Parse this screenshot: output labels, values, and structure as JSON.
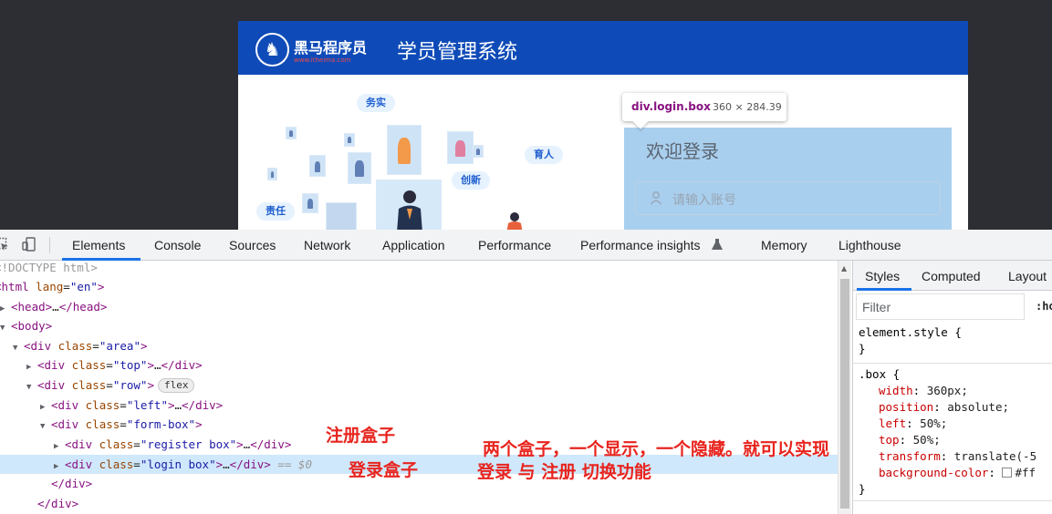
{
  "page": {
    "logo_name": "黑马程序员",
    "logo_url": "www.itheima.com",
    "system_title": "学员管理系统",
    "tags": [
      "务实",
      "育人",
      "创新",
      "责任"
    ],
    "login_title": "欢迎登录",
    "account_placeholder": "请输入账号"
  },
  "tooltip": {
    "element": "div.login.box",
    "size": "360 × 284.39"
  },
  "devtools": {
    "tabs": [
      "Elements",
      "Console",
      "Sources",
      "Network",
      "Application",
      "Performance",
      "Performance insights",
      "Memory",
      "Lighthouse"
    ],
    "active_tab": "Elements",
    "dom": {
      "doctype": "<!DOCTYPE html>",
      "html_tag": "html",
      "html_attr": "lang",
      "html_val": "\"en\"",
      "head": "head",
      "body": "body",
      "area_class": "\"area\"",
      "top_class": "\"top\"",
      "row_class": "\"row\"",
      "flex_badge": "flex",
      "left_class": "\"left\"",
      "formbox_class": "\"form-box\"",
      "register_class": "\"register box\"",
      "login_class": "\"login box\"",
      "selected_suffix": "== $0",
      "ellipsis": "…"
    },
    "styles_tabs": [
      "Styles",
      "Computed",
      "Layout"
    ],
    "active_styles_tab": "Styles",
    "filter_placeholder": "Filter",
    "hov_label": ":ho",
    "element_style": "element.style {",
    "rule_selector": ".box {",
    "rule_props": [
      {
        "prop": "width",
        "val": "360px;"
      },
      {
        "prop": "position",
        "val": "absolute;"
      },
      {
        "prop": "left",
        "val": "50%;"
      },
      {
        "prop": "top",
        "val": "50%;"
      },
      {
        "prop": "transform",
        "val": "translate(-5"
      },
      {
        "prop": "background-color",
        "val": "#ff"
      }
    ],
    "close_brace": "}"
  },
  "annotations": {
    "register_note": "注册盒子",
    "login_note": "登录盒子",
    "explain_line1": "两个盒子，一个显示，一个隐藏。就可以实现",
    "explain_line2": "登录 与 注册 切换功能"
  },
  "colors": {
    "header_blue": "#0f4bb8",
    "login_highlight": "#a9cfee",
    "annotation_red": "#e8241e",
    "selected_row": "#cfe8fc",
    "tab_accent": "#1a73e8"
  }
}
